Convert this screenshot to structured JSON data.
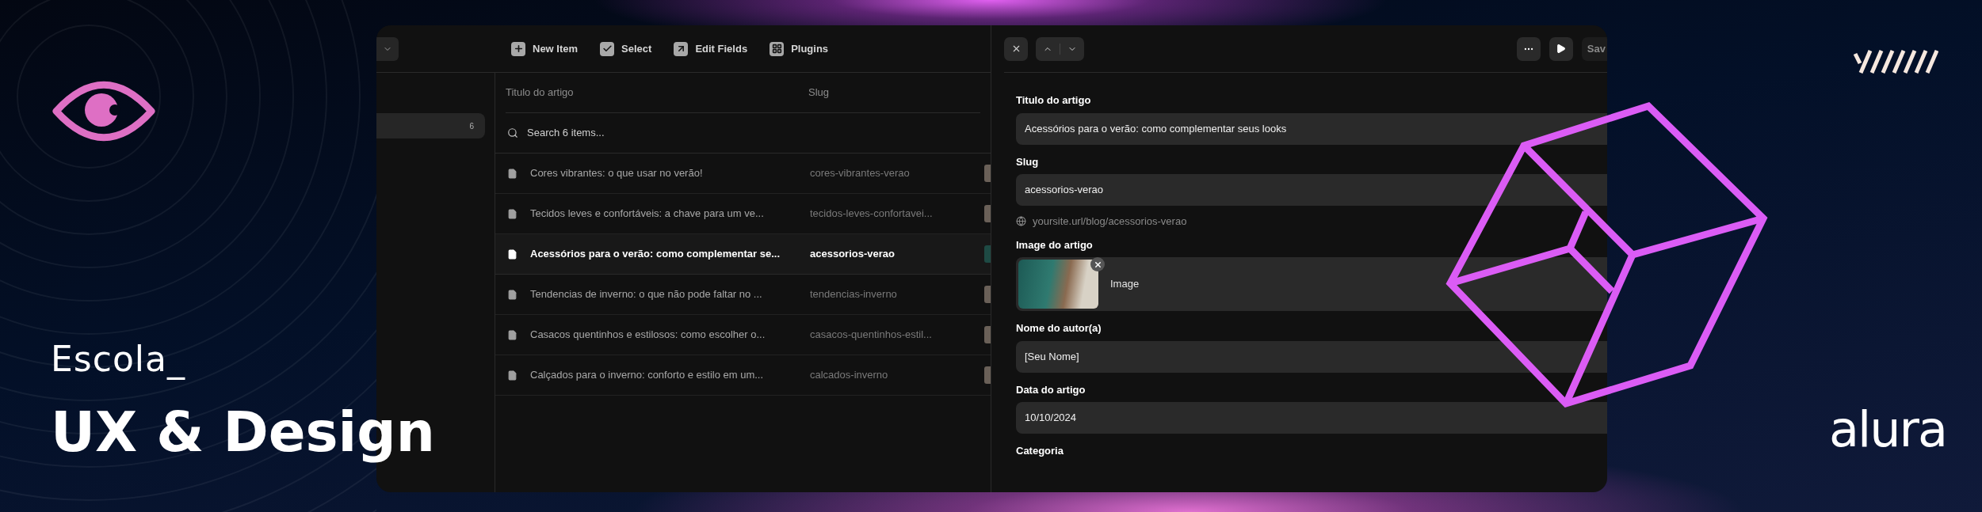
{
  "brand": {
    "school": "Escola_",
    "title": "UX & Design",
    "logo": "alura"
  },
  "cms": {
    "sidebar": {
      "count": "6"
    },
    "toolbar": [
      {
        "kind": "add",
        "label": "New Item"
      },
      {
        "kind": "select",
        "label": "Select"
      },
      {
        "kind": "edit",
        "label": "Edit Fields"
      },
      {
        "kind": "plugins",
        "label": "Plugins"
      }
    ],
    "table": {
      "columns": [
        "Titulo do artigo",
        "Slug"
      ],
      "search": {
        "placeholder": "Search 6 items..."
      },
      "rows": [
        {
          "title": "Cores vibrantes: o que usar no verão!",
          "slug": "cores-vibrantes-verao",
          "selected": false
        },
        {
          "title": "Tecidos leves e confortáveis: a chave para um ve...",
          "slug": "tecidos-leves-confortavei...",
          "selected": false
        },
        {
          "title": "Acessórios para o verão: como complementar se...",
          "slug": "acessorios-verao",
          "selected": true
        },
        {
          "title": "Tendencias de inverno: o que não pode faltar no ...",
          "slug": "tendencias-inverno",
          "selected": false
        },
        {
          "title": "Casacos quentinhos e estilosos: como escolher o...",
          "slug": "casacos-quentinhos-estil...",
          "selected": false
        },
        {
          "title": "Calçados para o inverno: conforto e estilo em um...",
          "slug": "calcados-inverno",
          "selected": false
        }
      ]
    },
    "editor": {
      "save_label": "Sav",
      "fields": [
        {
          "kind": "text",
          "label": "Titulo do artigo",
          "value": "Acessórios para o verão: como complementar seus looks"
        },
        {
          "kind": "slug",
          "label": "Slug",
          "value": "acessorios-verao",
          "hint": "yoursite.url/blog/acessorios-verao"
        },
        {
          "kind": "image",
          "label": "Image do artigo",
          "value": "Image"
        },
        {
          "kind": "text",
          "label": "Nome do autor(a)",
          "value": "[Seu Nome]"
        },
        {
          "kind": "text",
          "label": "Data do artigo",
          "value": "10/10/2024"
        },
        {
          "kind": "heading",
          "label": "Categoria"
        }
      ]
    }
  }
}
